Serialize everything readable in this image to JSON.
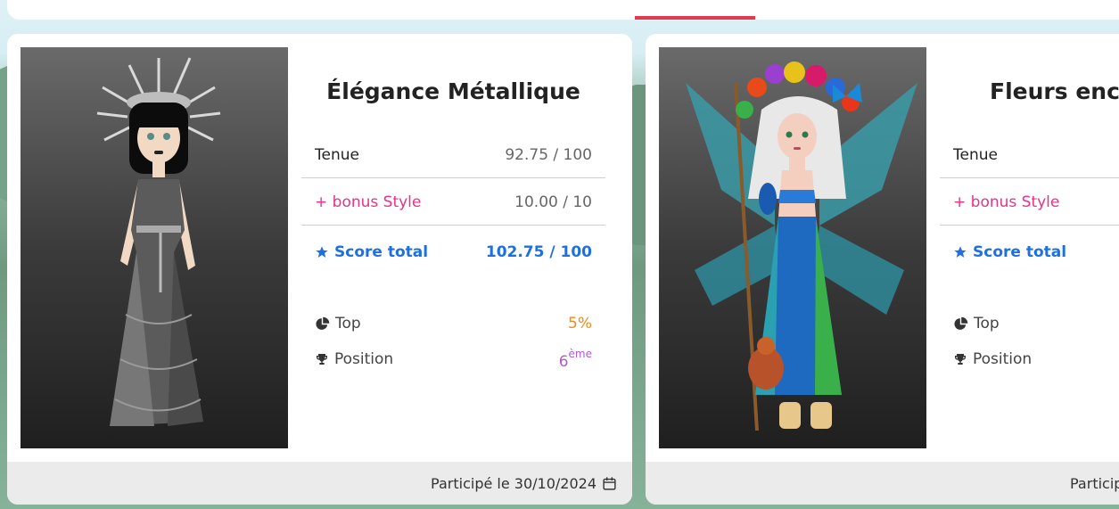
{
  "cards": [
    {
      "title": "Élégance Métallique",
      "outfit_label": "Tenue",
      "outfit_score": "92.75 / 100",
      "bonus_label": "+ bonus Style",
      "bonus_score": "10.00 / 10",
      "total_label": "Score total",
      "total_score": "102.75 / 100",
      "top_label": "Top",
      "top_value": "5%",
      "position_label": "Position",
      "position_value": "6",
      "position_suffix": "ème",
      "participated": "Participé le 30/10/2024"
    },
    {
      "title": "Fleurs ench",
      "outfit_label": "Tenue",
      "bonus_label": "+ bonus Style",
      "total_label": "Score total",
      "top_label": "Top",
      "position_label": "Position",
      "participated": "Particip"
    }
  ],
  "colors": {
    "accent_tab": "#e23a4e",
    "bonus": "#e8318a",
    "total": "#1e6fe0",
    "top_value": "#f08a16",
    "position_value": "#b05ad0"
  },
  "icons": [
    "star-icon",
    "pie-chart-icon",
    "trophy-icon",
    "calendar-icon"
  ]
}
